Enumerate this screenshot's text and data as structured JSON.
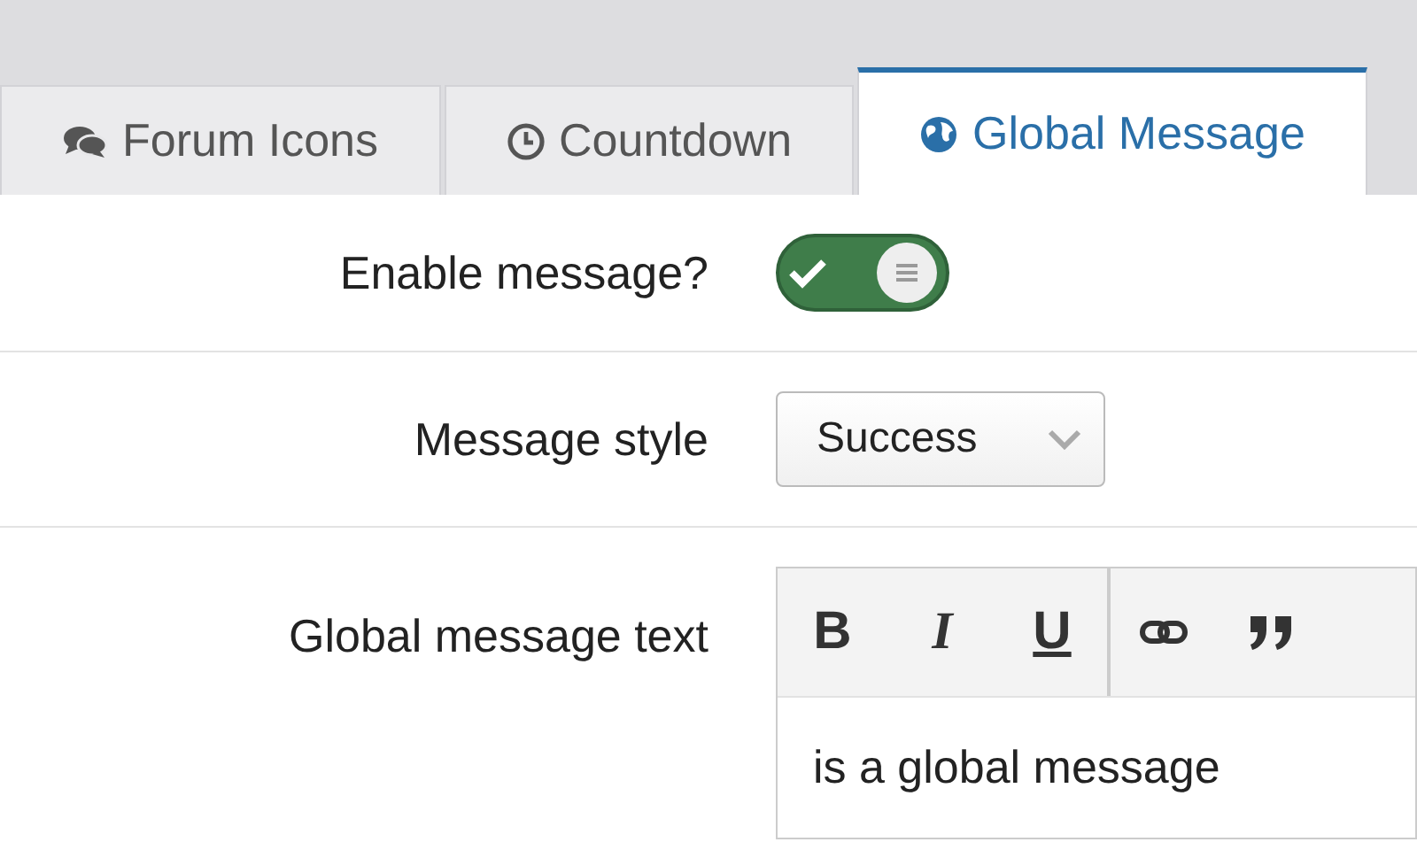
{
  "tabs": [
    {
      "label": "Forum Icons",
      "kind": "chat",
      "selected": false
    },
    {
      "label": "Countdown",
      "kind": "clock",
      "selected": false
    },
    {
      "label": "Global Message",
      "kind": "globe",
      "selected": true
    }
  ],
  "fields": [
    {
      "kind": "toggle",
      "label": "Enable message?",
      "on": true
    },
    {
      "kind": "select",
      "label": "Message style",
      "value": "Success"
    },
    {
      "kind": "editor",
      "label": "Global message text",
      "toolbar": [
        {
          "kind": "bold",
          "text": "B"
        },
        {
          "kind": "italic",
          "text": "I"
        },
        {
          "kind": "underline",
          "text": "U"
        },
        {
          "kind": "link"
        },
        {
          "kind": "quote"
        }
      ],
      "value": "is a global message"
    }
  ]
}
